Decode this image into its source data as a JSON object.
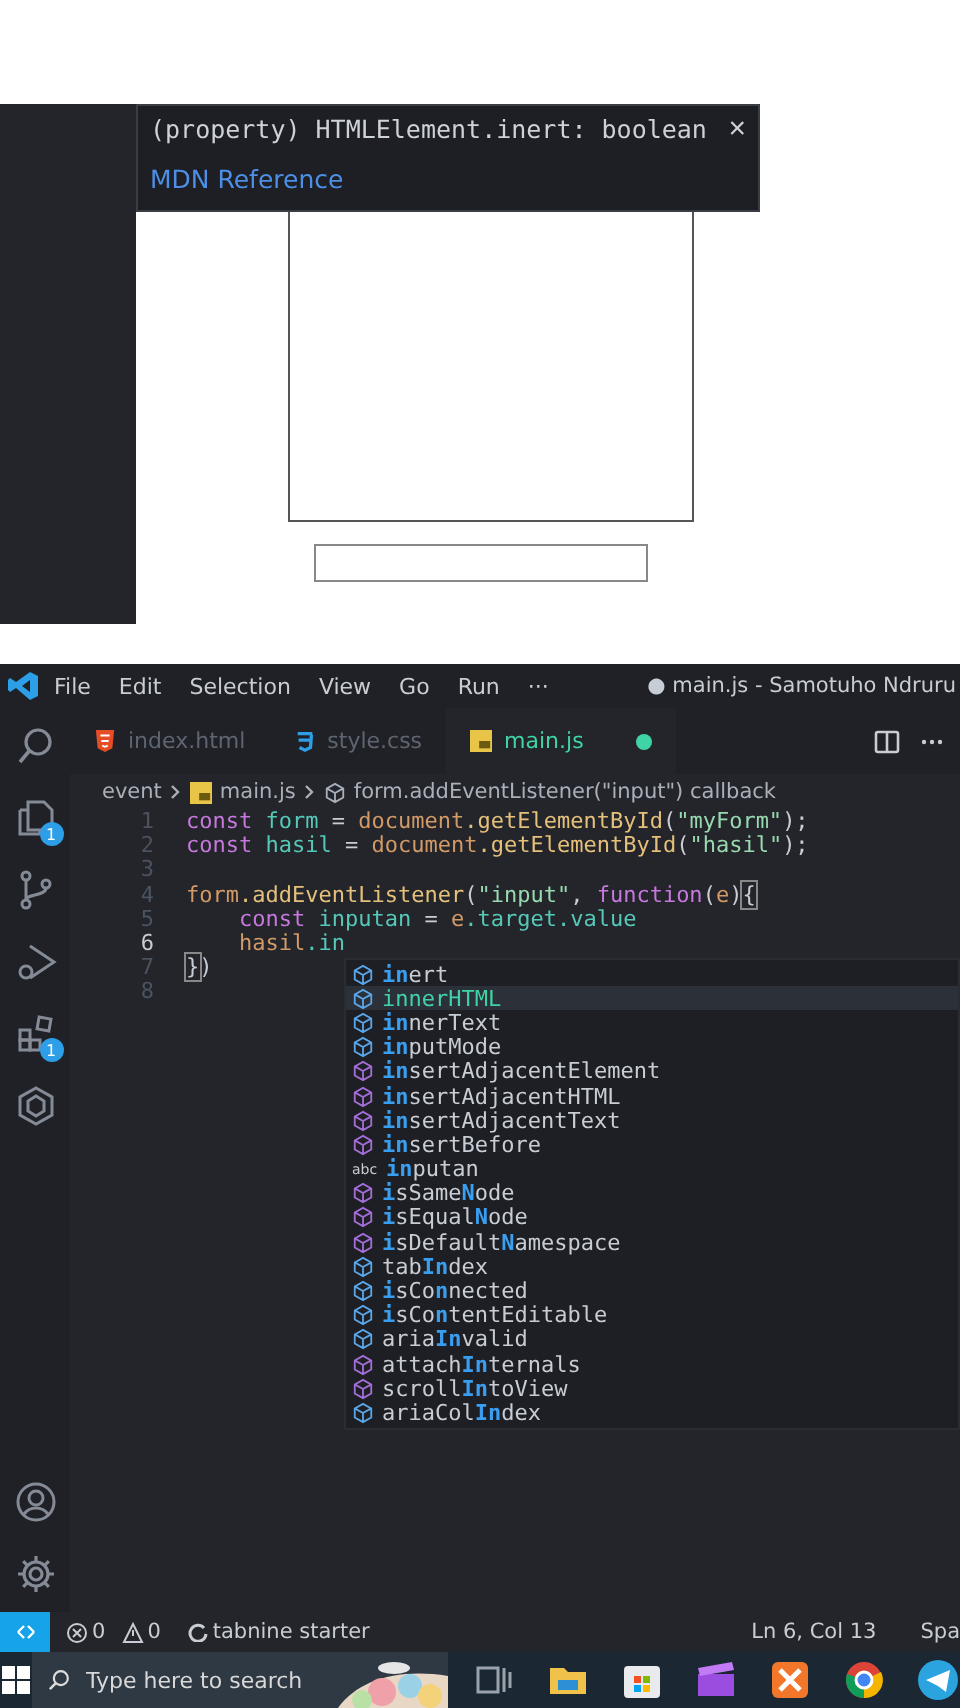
{
  "browser": {
    "tooltip": {
      "signature": "(property) HTMLElement.inert: boolean",
      "close": "×",
      "link": "MDN Reference"
    }
  },
  "editor": {
    "menu": [
      "File",
      "Edit",
      "Selection",
      "View",
      "Go",
      "Run",
      "···"
    ],
    "window_title": "● main.js - Samotuho Ndruru",
    "activity_bar": [
      {
        "kind": "search"
      },
      {
        "kind": "explorer",
        "badge": "1"
      },
      {
        "kind": "source-control"
      },
      {
        "kind": "run"
      },
      {
        "kind": "extensions",
        "badge": "1"
      },
      {
        "kind": "hexagon"
      }
    ],
    "tabs": [
      {
        "label": "index.html",
        "kind": "html",
        "selected": false,
        "modified": false
      },
      {
        "label": "style.css",
        "kind": "css",
        "selected": false,
        "modified": false
      },
      {
        "label": "main.js",
        "kind": "js",
        "selected": true,
        "modified": true
      }
    ],
    "tab_actions": [
      {
        "kind": "split"
      },
      {
        "kind": "more"
      }
    ],
    "breadcrumb": [
      "event",
      "main.js",
      "form.addEventListener(\"input\") callback"
    ],
    "lines": [
      {
        "number": "1",
        "current": false,
        "tokens": [
          {
            "text": "const ",
            "kind": "keyword"
          },
          {
            "text": "form",
            "kind": "variable"
          },
          {
            "text": " = ",
            "kind": "plain"
          },
          {
            "text": "document",
            "kind": "object"
          },
          {
            "text": ".getElementById",
            "kind": "method"
          },
          {
            "text": "(",
            "kind": "plain"
          },
          {
            "text": "\"myForm\"",
            "kind": "string"
          },
          {
            "text": ");",
            "kind": "plain"
          }
        ]
      },
      {
        "number": "2",
        "current": false,
        "tokens": [
          {
            "text": "const ",
            "kind": "keyword"
          },
          {
            "text": "hasil",
            "kind": "variable"
          },
          {
            "text": " = ",
            "kind": "plain"
          },
          {
            "text": "document",
            "kind": "object"
          },
          {
            "text": ".getElementById",
            "kind": "method"
          },
          {
            "text": "(",
            "kind": "plain"
          },
          {
            "text": "\"hasil\"",
            "kind": "string"
          },
          {
            "text": ");",
            "kind": "plain"
          }
        ]
      },
      {
        "number": "3",
        "current": false
      },
      {
        "number": "4",
        "current": false,
        "tokens": [
          {
            "text": "form",
            "kind": "object"
          },
          {
            "text": ".addEventListener",
            "kind": "method"
          },
          {
            "text": "(",
            "kind": "plain"
          },
          {
            "text": "\"input\"",
            "kind": "string"
          },
          {
            "text": ", ",
            "kind": "plain"
          },
          {
            "text": "function",
            "kind": "keyword"
          },
          {
            "text": "(",
            "kind": "plain"
          },
          {
            "text": "e",
            "kind": "object"
          },
          {
            "text": ")",
            "kind": "plain"
          },
          {
            "text": "{",
            "kind": "bracket"
          }
        ]
      },
      {
        "number": "5",
        "current": false,
        "tokens": [
          {
            "text": "    const ",
            "kind": "keyword"
          },
          {
            "text": "inputan",
            "kind": "variable"
          },
          {
            "text": " = ",
            "kind": "plain"
          },
          {
            "text": "e",
            "kind": "object"
          },
          {
            "text": ".target.value",
            "kind": "variable"
          }
        ]
      },
      {
        "number": "6",
        "current": true,
        "tokens": [
          {
            "text": "    hasil",
            "kind": "object"
          },
          {
            "text": ".in",
            "kind": "variable"
          }
        ]
      },
      {
        "number": "7",
        "current": false,
        "tokens": [
          {
            "text": "}",
            "kind": "bracket"
          },
          {
            "text": ")",
            "kind": "plain"
          }
        ]
      },
      {
        "number": "8",
        "current": false
      }
    ],
    "suggestions": [
      {
        "kind": "property",
        "selected": false,
        "parts": [
          {
            "text": "in",
            "match": true
          },
          {
            "text": "ert",
            "match": false
          }
        ]
      },
      {
        "kind": "property",
        "selected": true,
        "parts": [
          {
            "text": "innerHTML",
            "match": false
          }
        ]
      },
      {
        "kind": "property",
        "selected": false,
        "parts": [
          {
            "text": "in",
            "match": true
          },
          {
            "text": "nerText",
            "match": false
          }
        ]
      },
      {
        "kind": "property",
        "selected": false,
        "parts": [
          {
            "text": "in",
            "match": true
          },
          {
            "text": "putMode",
            "match": false
          }
        ]
      },
      {
        "kind": "method",
        "selected": false,
        "parts": [
          {
            "text": "in",
            "match": true
          },
          {
            "text": "sertAdjacentElement",
            "match": false
          }
        ]
      },
      {
        "kind": "method",
        "selected": false,
        "parts": [
          {
            "text": "in",
            "match": true
          },
          {
            "text": "sertAdjacentHTML",
            "match": false
          }
        ]
      },
      {
        "kind": "method",
        "selected": false,
        "parts": [
          {
            "text": "in",
            "match": true
          },
          {
            "text": "sertAdjacentText",
            "match": false
          }
        ]
      },
      {
        "kind": "method",
        "selected": false,
        "parts": [
          {
            "text": "in",
            "match": true
          },
          {
            "text": "sertBefore",
            "match": false
          }
        ]
      },
      {
        "kind": "text",
        "badge": "abc",
        "selected": false,
        "parts": [
          {
            "text": "in",
            "match": true
          },
          {
            "text": "putan",
            "match": false
          }
        ]
      },
      {
        "kind": "method",
        "selected": false,
        "parts": [
          {
            "text": "i",
            "match": true
          },
          {
            "text": "sSame",
            "match": false
          },
          {
            "text": "N",
            "match": true
          },
          {
            "text": "ode",
            "match": false
          }
        ]
      },
      {
        "kind": "method",
        "selected": false,
        "parts": [
          {
            "text": "i",
            "match": true
          },
          {
            "text": "sEqual",
            "match": false
          },
          {
            "text": "N",
            "match": true
          },
          {
            "text": "ode",
            "match": false
          }
        ]
      },
      {
        "kind": "method",
        "selected": false,
        "parts": [
          {
            "text": "i",
            "match": true
          },
          {
            "text": "sDefault",
            "match": false
          },
          {
            "text": "N",
            "match": true
          },
          {
            "text": "amespace",
            "match": false
          }
        ]
      },
      {
        "kind": "property",
        "selected": false,
        "parts": [
          {
            "text": "tab",
            "match": false
          },
          {
            "text": "In",
            "match": true
          },
          {
            "text": "dex",
            "match": false
          }
        ]
      },
      {
        "kind": "property",
        "selected": false,
        "parts": [
          {
            "text": "i",
            "match": true
          },
          {
            "text": "sCo",
            "match": false
          },
          {
            "text": "n",
            "match": true
          },
          {
            "text": "nected",
            "match": false
          }
        ]
      },
      {
        "kind": "property",
        "selected": false,
        "parts": [
          {
            "text": "i",
            "match": true
          },
          {
            "text": "sCo",
            "match": false
          },
          {
            "text": "n",
            "match": true
          },
          {
            "text": "tentEditable",
            "match": false
          }
        ]
      },
      {
        "kind": "property",
        "selected": false,
        "parts": [
          {
            "text": "aria",
            "match": false
          },
          {
            "text": "In",
            "match": true
          },
          {
            "text": "valid",
            "match": false
          }
        ]
      },
      {
        "kind": "method",
        "selected": false,
        "parts": [
          {
            "text": "attach",
            "match": false
          },
          {
            "text": "In",
            "match": true
          },
          {
            "text": "ternals",
            "match": false
          }
        ]
      },
      {
        "kind": "method",
        "selected": false,
        "parts": [
          {
            "text": "scroll",
            "match": false
          },
          {
            "text": "In",
            "match": true
          },
          {
            "text": "toView",
            "match": false
          }
        ]
      },
      {
        "kind": "property",
        "selected": false,
        "parts": [
          {
            "text": "ariaCol",
            "match": false
          },
          {
            "text": "In",
            "match": true
          },
          {
            "text": "dex",
            "match": false
          }
        ]
      }
    ],
    "status_bar": {
      "errors": "0",
      "warnings": "0",
      "extension": "tabnine starter",
      "position": "Ln 6, Col 13",
      "indent": "Spa"
    }
  },
  "taskbar": {
    "search": {
      "placeholder": "Type here to search"
    },
    "apps": [
      {
        "kind": "task-view"
      },
      {
        "kind": "folder"
      },
      {
        "kind": "store"
      },
      {
        "kind": "purple-app"
      },
      {
        "kind": "orange-app"
      },
      {
        "kind": "browser"
      },
      {
        "kind": "messenger"
      }
    ]
  }
}
